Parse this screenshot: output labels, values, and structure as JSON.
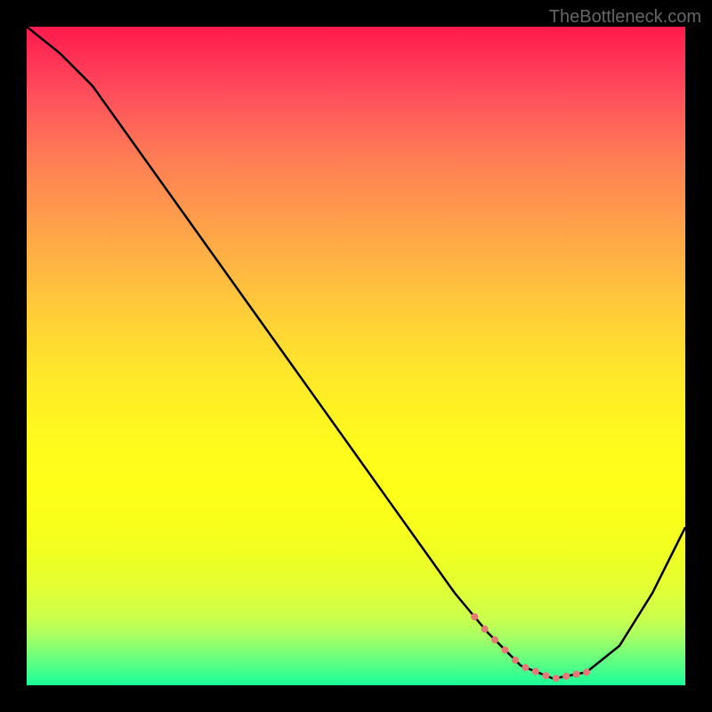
{
  "watermark": "TheBottleneck.com",
  "chart_data": {
    "type": "line",
    "title": "",
    "xlabel": "",
    "ylabel": "",
    "description": "Bottleneck curve with V-shape showing optimal point near right side, starting high at left, dipping to minimum around 75-80% then rising again",
    "x": [
      0,
      5,
      10,
      15,
      20,
      25,
      30,
      35,
      40,
      45,
      50,
      55,
      60,
      65,
      70,
      75,
      80,
      85,
      90,
      95,
      100
    ],
    "y": [
      100,
      96,
      91,
      84,
      77,
      70,
      63,
      56,
      49,
      42,
      35,
      28,
      21,
      14,
      8,
      3,
      1,
      2,
      6,
      14,
      24
    ],
    "markers": {
      "description": "Pink/red dotted markers at the bottom of the V curve indicating optimal range",
      "x_range": [
        68,
        85
      ],
      "color": "#e87878"
    },
    "background_gradient": {
      "type": "vertical",
      "colors": [
        "#ff1a4d",
        "#ff7d55",
        "#ffd236",
        "#fffc1c",
        "#caff4d",
        "#1aff99"
      ],
      "stops": [
        0,
        20,
        45,
        65,
        90,
        100
      ]
    }
  }
}
